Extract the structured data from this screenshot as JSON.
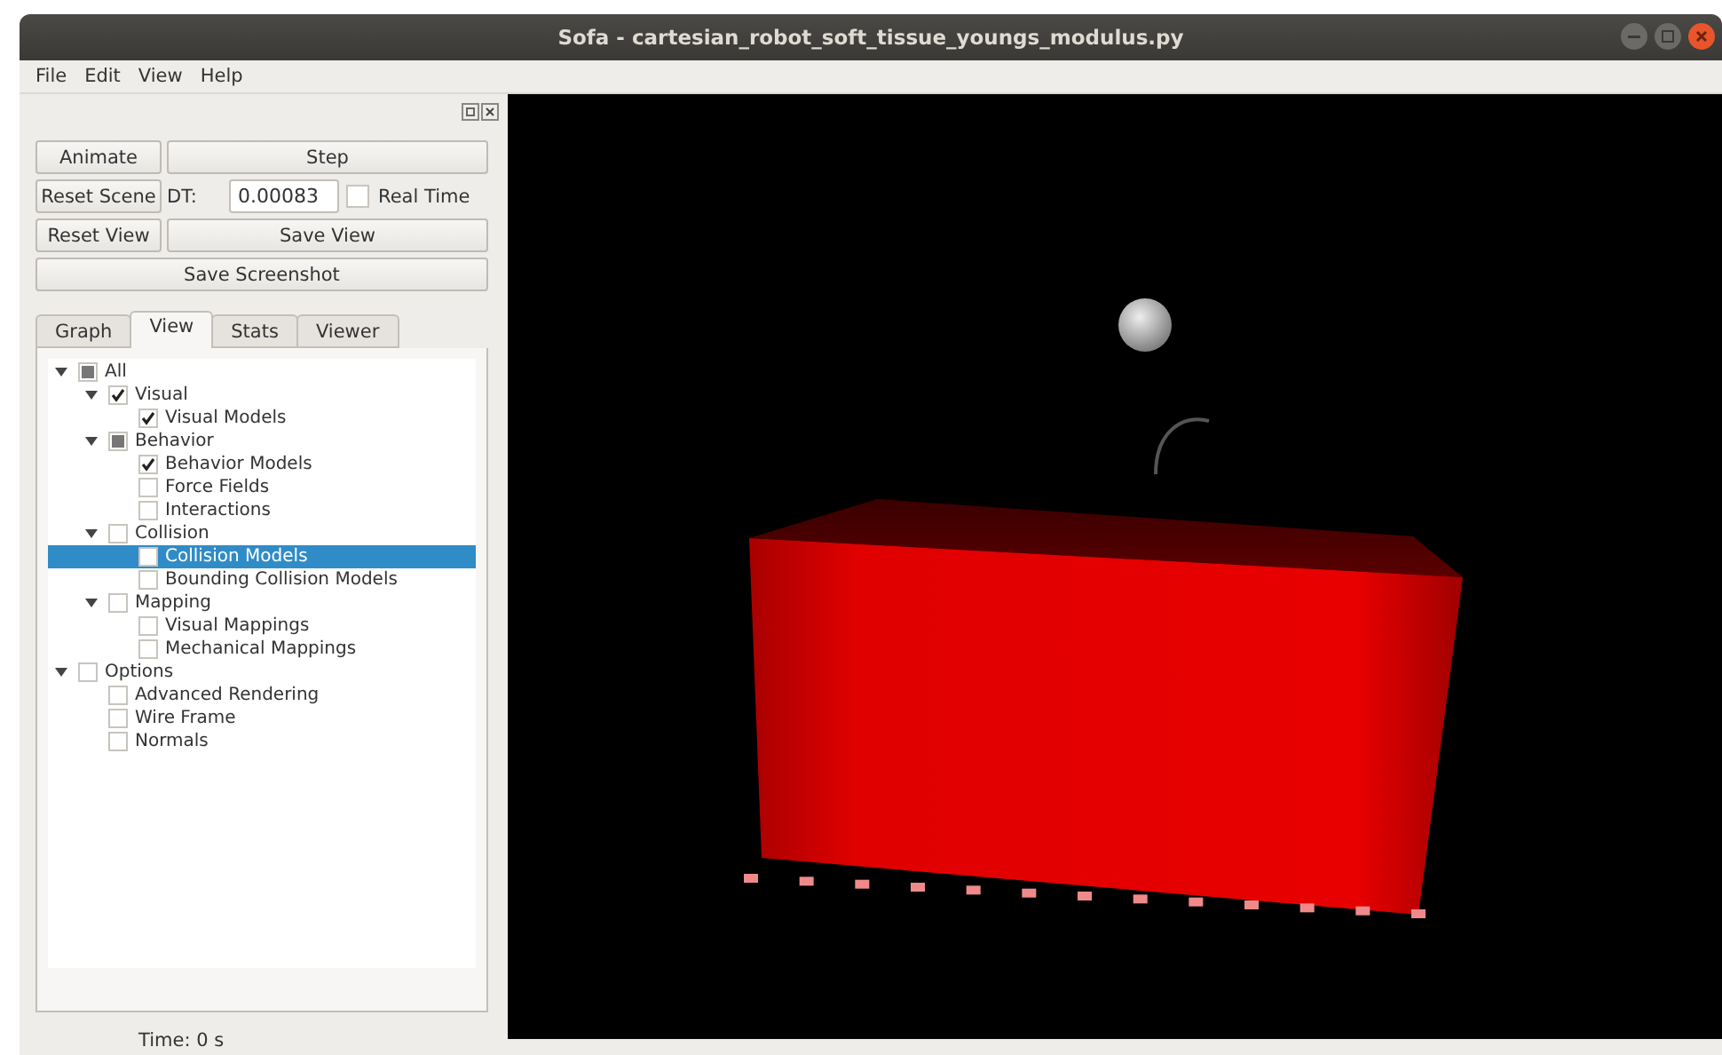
{
  "window": {
    "title": "Sofa - cartesian_robot_soft_tissue_youngs_modulus.py"
  },
  "menu": [
    "File",
    "Edit",
    "View",
    "Help"
  ],
  "controls": {
    "animate": "Animate",
    "step": "Step",
    "reset_scene": "Reset Scene",
    "dt_label": "DT:",
    "dt_value": "0.00083",
    "real_time": {
      "label": "Real Time",
      "checked": false
    },
    "reset_view": "Reset View",
    "save_view": "Save View",
    "save_screenshot": "Save Screenshot"
  },
  "tabs": [
    {
      "label": "Graph",
      "selected": false
    },
    {
      "label": "View",
      "selected": true
    },
    {
      "label": "Stats",
      "selected": false
    },
    {
      "label": "Viewer",
      "selected": false
    }
  ],
  "tree": [
    {
      "label": "All",
      "checked": false,
      "partial": true,
      "expanded": true,
      "selected": false,
      "children": [
        {
          "label": "Visual",
          "checked": true,
          "partial": false,
          "expanded": true,
          "selected": false,
          "children": [
            {
              "label": "Visual Models",
              "checked": true,
              "partial": false,
              "selected": false
            }
          ]
        },
        {
          "label": "Behavior",
          "checked": false,
          "partial": true,
          "expanded": true,
          "selected": false,
          "children": [
            {
              "label": "Behavior Models",
              "checked": true,
              "partial": false,
              "selected": false
            },
            {
              "label": "Force Fields",
              "checked": false,
              "partial": false,
              "selected": false
            },
            {
              "label": "Interactions",
              "checked": false,
              "partial": false,
              "selected": false
            }
          ]
        },
        {
          "label": "Collision",
          "checked": false,
          "partial": false,
          "expanded": true,
          "selected": false,
          "children": [
            {
              "label": "Collision Models",
              "checked": false,
              "partial": false,
              "selected": true
            },
            {
              "label": "Bounding Collision Models",
              "checked": false,
              "partial": false,
              "selected": false
            }
          ]
        },
        {
          "label": "Mapping",
          "checked": false,
          "partial": false,
          "expanded": true,
          "selected": false,
          "children": [
            {
              "label": "Visual Mappings",
              "checked": false,
              "partial": false,
              "selected": false
            },
            {
              "label": "Mechanical Mappings",
              "checked": false,
              "partial": false,
              "selected": false
            }
          ]
        }
      ]
    },
    {
      "label": "Options",
      "checked": false,
      "partial": false,
      "expanded": true,
      "selected": false,
      "children": [
        {
          "label": "Advanced Rendering",
          "checked": false,
          "partial": false,
          "selected": false
        },
        {
          "label": "Wire Frame",
          "checked": false,
          "partial": false,
          "selected": false
        },
        {
          "label": "Normals",
          "checked": false,
          "partial": false,
          "selected": false
        }
      ]
    }
  ],
  "status_bar": {
    "time": "Time: 0 s"
  }
}
